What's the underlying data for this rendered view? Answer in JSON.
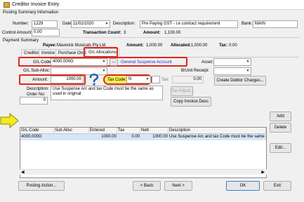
{
  "window": {
    "title": "Creditor Invoice Entry"
  },
  "posting_summary": {
    "header": "Posting Summary Information",
    "number_label": "Number:",
    "number_value": "1229",
    "date_label": "Date:",
    "date_value": "11/02/2020",
    "description_label": "Description:",
    "description_value": "Pre Paying GST - i.e contract requirement",
    "bank_label": "Bank:",
    "bank_value": "MAIN",
    "control_amount_label": "Control Amount:",
    "control_amount_value": "0.00",
    "transaction_count_label": "Transaction Count:",
    "transaction_count_value": "3",
    "amount_label": "Amount:",
    "amount_value": "1,100.00"
  },
  "payment_summary": {
    "header": "Payment Summary",
    "payee_label": "Payee:",
    "payee_value": "Maverick Musicals Pty Ltd",
    "amount_label": "Amount:",
    "amount_value": "1,000.00",
    "allocated_label": "Allocated:",
    "allocated_value": "1,000.00",
    "tax_label": "Tax:",
    "tax_value": "0.00"
  },
  "tabs": [
    "Creditor",
    "Invoice",
    "Purchase Orders",
    "G/L Allocations"
  ],
  "form": {
    "gl_code_label": "G/L Code:",
    "gl_code_value": "4000.000G",
    "gl_code_lookup": "...",
    "gl_code_desc": "General Suspense Account",
    "gl_suballoc_label": "G/L Sub-Alloc:",
    "gl_suballoc_value": "",
    "asset_label": "Asset:",
    "asset_value": "",
    "unit_receipt_label": "B/Unit Receipt:",
    "unit_receipt_value": "",
    "amount_label": "Amount:",
    "amount_value": "1000.00",
    "tax_code_label": "Tax Code:",
    "tax_code_value": "N",
    "tax_label": "Tax:",
    "tax_value": "0.00",
    "create_debtor_label": "Create Debtor Charges...",
    "description_label": "Description:",
    "description_value": "Use Suspense A/c and tax Code must be the same as used in original",
    "order_no_label": "Order No:",
    "order_no_value": "0",
    "tax_adjust_label": "Tax Adjust...",
    "copy_invoice_label": "Copy Invoice Desc"
  },
  "grid": {
    "columns": [
      "G/L Code",
      "Sub Alloc",
      "Entered",
      "Tax",
      "Nett",
      "Description"
    ],
    "rows": [
      [
        "4000.000G",
        "",
        "1000.00",
        "0.00",
        "1000.00",
        "Use Suspense A/c and tax Code must be the same as"
      ]
    ]
  },
  "side_buttons": {
    "add": "Add",
    "delete": "Delete",
    "edit": "Edit..."
  },
  "bottom_buttons": {
    "posting_action": "Posting Action...",
    "back": "< Back",
    "next": "Next >",
    "ok": "OK",
    "exit": "Exit"
  },
  "colors": {
    "highlight_red": "#e0261b",
    "arrow_yellow": "#f5ea1d",
    "question_blue": "#2f5fa8",
    "tax_highlight": "#f5ee57",
    "row_select": "#d4e6f7",
    "link_blue": "#1a35c8"
  }
}
